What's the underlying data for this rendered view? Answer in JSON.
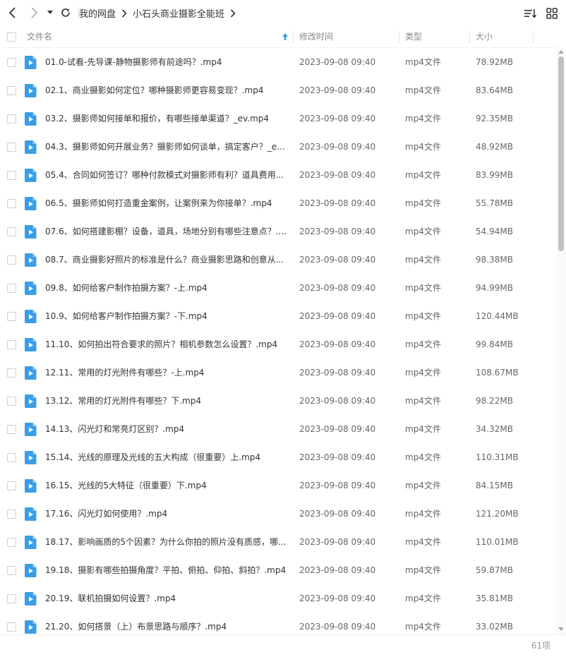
{
  "toolbar": {
    "breadcrumbs": [
      "我的网盘",
      "小石头商业摄影全能班"
    ]
  },
  "list_header": {
    "name": "文件名",
    "modified": "修改时间",
    "type": "类型",
    "size": "大小"
  },
  "files": [
    {
      "name": "01.0-试看-先导课-静物摄影师有前途吗？.mp4",
      "date": "2023-09-08 09:40",
      "type": "mp4文件",
      "size": "78.92MB"
    },
    {
      "name": "02.1、商业摄影如何定位？哪种摄影师更容易变现？.mp4",
      "date": "2023-09-08 09:40",
      "type": "mp4文件",
      "size": "83.64MB"
    },
    {
      "name": "03.2、摄影师如何接单和报价，有哪些接单渠道？_ev.mp4",
      "date": "2023-09-08 09:40",
      "type": "mp4文件",
      "size": "92.35MB"
    },
    {
      "name": "04.3、摄影师如何开展业务？摄影师如何谈单，搞定客户？_ev....",
      "date": "2023-09-08 09:40",
      "type": "mp4文件",
      "size": "48.92MB"
    },
    {
      "name": "05.4、合同如何签订？哪种付款模式对摄影师有利？道具费用...",
      "date": "2023-09-08 09:40",
      "type": "mp4文件",
      "size": "83.99MB"
    },
    {
      "name": "06.5、摄影师如何打造重金案例，让案例来为你接单？.mp4",
      "date": "2023-09-08 09:40",
      "type": "mp4文件",
      "size": "55.78MB"
    },
    {
      "name": "07.6、如何搭建影棚？设备，道具，场地分别有哪些注意点？....",
      "date": "2023-09-08 09:40",
      "type": "mp4文件",
      "size": "54.94MB"
    },
    {
      "name": "08.7、商业摄影好照片的标准是什么？商业摄影思路和创意从...",
      "date": "2023-09-08 09:40",
      "type": "mp4文件",
      "size": "98.38MB"
    },
    {
      "name": "09.8、如何给客户制作拍摄方案？-上.mp4",
      "date": "2023-09-08 09:40",
      "type": "mp4文件",
      "size": "94.99MB"
    },
    {
      "name": "10.9、如何给客户制作拍摄方案？-下.mp4",
      "date": "2023-09-08 09:40",
      "type": "mp4文件",
      "size": "120.44MB"
    },
    {
      "name": "11.10、如何拍出符合要求的照片？相机参数怎么设置？.mp4",
      "date": "2023-09-08 09:40",
      "type": "mp4文件",
      "size": "99.84MB"
    },
    {
      "name": "12.11、常用的灯光附件有哪些？-上.mp4",
      "date": "2023-09-08 09:40",
      "type": "mp4文件",
      "size": "108.67MB"
    },
    {
      "name": "13.12、常用的灯光附件有哪些？下.mp4",
      "date": "2023-09-08 09:40",
      "type": "mp4文件",
      "size": "98.22MB"
    },
    {
      "name": "14.13、闪光灯和常亮灯区别？.mp4",
      "date": "2023-09-08 09:40",
      "type": "mp4文件",
      "size": "34.32MB"
    },
    {
      "name": "15.14、光线的原理及光线的五大构成（很重要）上.mp4",
      "date": "2023-09-08 09:40",
      "type": "mp4文件",
      "size": "110.31MB"
    },
    {
      "name": "16.15、光线的5大特征（很重要）下.mp4",
      "date": "2023-09-08 09:40",
      "type": "mp4文件",
      "size": "84.15MB"
    },
    {
      "name": "17.16、闪光灯如何使用？.mp4",
      "date": "2023-09-08 09:40",
      "type": "mp4文件",
      "size": "121.20MB"
    },
    {
      "name": "18.17、影响画质的5个因素？为什么你拍的照片没有质感，哪...",
      "date": "2023-09-08 09:40",
      "type": "mp4文件",
      "size": "110.01MB"
    },
    {
      "name": "19.18、摄影有哪些拍摄角度？平拍、俯拍、仰拍、斜拍？.mp4",
      "date": "2023-09-08 09:40",
      "type": "mp4文件",
      "size": "59.87MB"
    },
    {
      "name": "20.19、联机拍摄如何设置？.mp4",
      "date": "2023-09-08 09:40",
      "type": "mp4文件",
      "size": "35.81MB"
    },
    {
      "name": "21.20、如何搭景（上）布景思路与顺序？.mp4",
      "date": "2023-09-08 09:40",
      "type": "mp4文件",
      "size": "33.02MB"
    }
  ],
  "footer": {
    "count": "61项"
  },
  "icons": {
    "file": "video-file-icon",
    "sort": "sort-ascending-icon"
  },
  "colors": {
    "accent": "#2f9ee8",
    "file_icon": "#3a9ee6"
  }
}
